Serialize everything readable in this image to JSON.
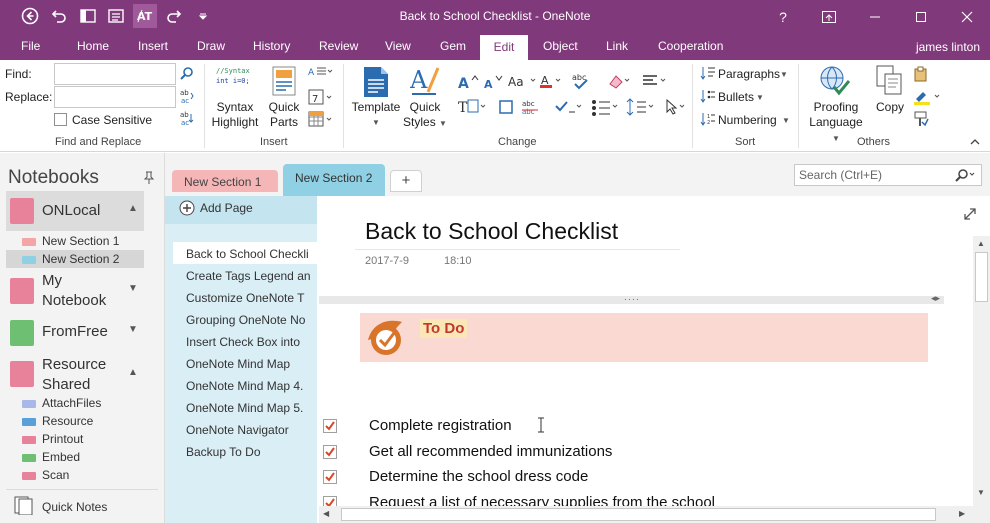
{
  "window": {
    "title": "Back to School Checklist - OneNote",
    "controls": [
      "help-icon",
      "restore-ribbon-icon",
      "minimize-icon",
      "maximize-icon",
      "close-icon"
    ]
  },
  "ribbon_tabs": [
    "File",
    "Home",
    "Insert",
    "Draw",
    "History",
    "Review",
    "View",
    "Gem",
    "Edit",
    "Object",
    "Link",
    "Cooperation"
  ],
  "active_tab": "Edit",
  "user": "james linton",
  "find_replace": {
    "find_label": "Find:",
    "replace_label": "Replace:",
    "find_value": "",
    "replace_value": "",
    "case_sensitive_label": "Case Sensitive",
    "group_label": "Find and Replace"
  },
  "insert_group": {
    "syntax_code_line1": "//Syntax",
    "syntax_code_line2": "int i=0;",
    "syntax_label_1": "Syntax",
    "syntax_label_2": "Highlight",
    "quick_parts_label_1": "Quick",
    "quick_parts_label_2": "Parts",
    "group_label": "Insert"
  },
  "change_group": {
    "template_label": "Template",
    "quick_styles_label_1": "Quick",
    "quick_styles_label_2": "Styles",
    "group_label": "Change"
  },
  "sort_group": {
    "paragraphs_label": "Paragraphs",
    "bullets_label": "Bullets",
    "numbering_label": "Numbering",
    "group_label": "Sort"
  },
  "others_group": {
    "proofing_label_1": "Proofing",
    "proofing_label_2": "Language",
    "copy_label": "Copy",
    "group_label": "Others"
  },
  "notebooks_title": "Notebooks",
  "notebooks": [
    {
      "name": "ONLocal",
      "color": "#e8829a"
    },
    {
      "name": "My Notebook",
      "color": "#e8829a"
    },
    {
      "name": "FromFree",
      "color": "#6fbf73"
    },
    {
      "name": "Resource Shared",
      "color": "#e8829a"
    }
  ],
  "onlocal_sections": [
    {
      "name": "New Section 1",
      "color": "#f4a6a6"
    },
    {
      "name": "New Section 2",
      "color": "#8fd0e4"
    }
  ],
  "resource_sections": [
    {
      "name": "AttachFiles",
      "color": "#a8b8e8"
    },
    {
      "name": "Resource",
      "color": "#5aa0d8"
    },
    {
      "name": "Printout",
      "color": "#e8829a"
    },
    {
      "name": "Embed",
      "color": "#6fbf73"
    },
    {
      "name": "Scan",
      "color": "#e8829a"
    }
  ],
  "quick_notes_label": "Quick Notes",
  "section_tabs": [
    {
      "name": "New Section 1",
      "color": "#f4b6b6"
    },
    {
      "name": "New Section 2",
      "color": "#8fd0e4"
    }
  ],
  "search_placeholder": "Search (Ctrl+E)",
  "add_page_label": "Add Page",
  "pages": [
    "Back to School Checkli",
    "Create Tags Legend an",
    "Customize OneNote T",
    "Grouping OneNote No",
    "Insert Check Box into",
    "OneNote Mind Map",
    "OneNote Mind Map 4.",
    "OneNote Mind Map 5.",
    "OneNote Navigator",
    "Backup To Do"
  ],
  "page": {
    "title": "Back to School Checklist",
    "date": "2017-7-9",
    "time": "18:10",
    "todo_label": "To Do",
    "tasks": [
      "Complete registration",
      "Get all recommended immunizations",
      "Determine the school dress code",
      "Request a list of necessary supplies from the school"
    ]
  },
  "colors": {
    "brand": "#80397b",
    "todo_bg": "#f9d9d1",
    "check": "#d9472b"
  }
}
